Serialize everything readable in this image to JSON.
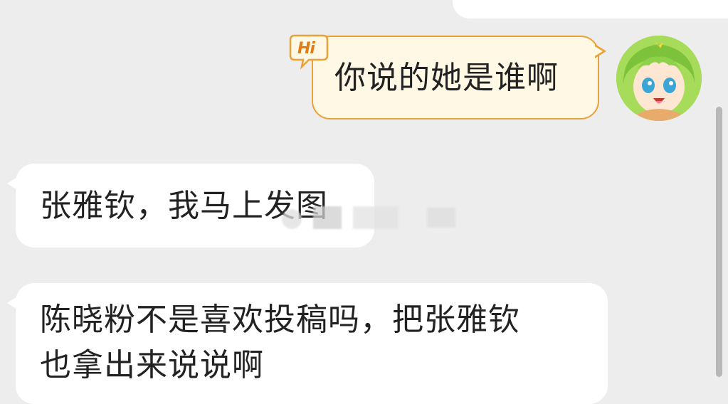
{
  "chat": {
    "messages": [
      {
        "side": "right",
        "badge": "Hi",
        "text": "你说的她是谁啊"
      },
      {
        "side": "left",
        "text": "张雅钦，我马上发图"
      },
      {
        "side": "left",
        "lines": [
          "陈晓粉不是喜欢投稿吗，把张雅钦",
          "也拿出来说说啊"
        ]
      }
    ]
  },
  "colors": {
    "background": "#ededed",
    "bubble_in": "#ffffff",
    "bubble_out_fill": "#fff8e4",
    "bubble_out_border": "#e8a23a",
    "hi_badge": "#e07d17",
    "avatar_hair": "#8fd14b"
  },
  "icons": {
    "hi_badge": "hi-sticker-icon",
    "avatar": "anime-girl-avatar"
  }
}
